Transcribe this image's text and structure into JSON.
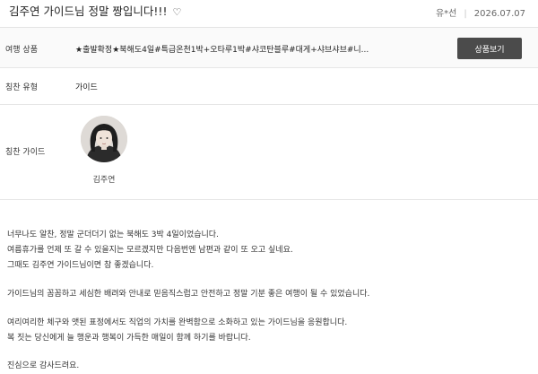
{
  "review": {
    "title": "김주연 가이드님 정말 짱입니다!!!",
    "heart_icon": "heart-icon",
    "author": "유*선",
    "date": "2026.07.07"
  },
  "product": {
    "label": "여행 상품",
    "value": "★출발확정★북해도4일#특급온천1박+오타루1박#샤코탄블루#대게+샤브샤브#니...",
    "button_label": "상품보기"
  },
  "praise_type": {
    "label": "칭찬 유형",
    "value": "가이드"
  },
  "praise_guide": {
    "label": "칭찬 가이드",
    "name": "김주연"
  },
  "body": {
    "line1": "너무나도 알찬, 정말 군더더기 없는 북해도 3박 4일이었습니다.",
    "line2": "여름휴가를 언제 또 갈 수 있을지는 모르겠지만 다음번엔 남편과 같이 또 오고 싶네요.",
    "line3": "그때도 김주연 가이드님이면 참 좋겠습니다.",
    "line4": "가이드님의 꼼꼼하고 세심한 배려와 안내로 믿음직스럽고 안전하고 정말 기분 좋은 여행이 될 수 있었습니다.",
    "line5": "여리여리한 체구와 앳된 표정에서도 직업의 가치를 완벽함으로 소화하고 있는 가이드님을 응원합니다.",
    "line6": "복 짓는 당신에게 늘 행운과 행복이 가득한 매일이 함께 하기를 바랍니다.",
    "line7": "진심으로 감사드려요."
  }
}
